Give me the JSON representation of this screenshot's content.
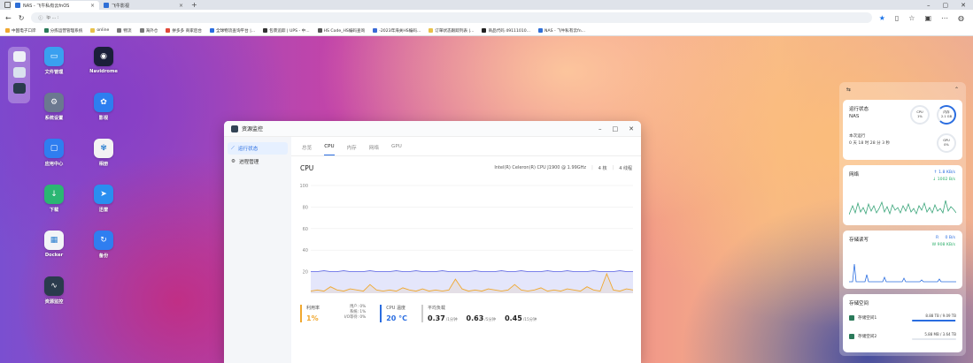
{
  "browser": {
    "tabs": [
      {
        "label": "NAS - 飞牛私有云fnOS",
        "active": true
      },
      {
        "label": "飞牛影视",
        "active": false
      }
    ],
    "address": "ip ... :",
    "bookmarks": [
      "中国电子口岸",
      "分拣运营管理系统",
      "online",
      "物流",
      "海外仓",
      "拼多多 商家后台",
      "全球物流查询平台 |...",
      "包裹追踪 | UPS - 中...",
      "HS Code_HS编码查询",
      "-2023年海关HS编码...",
      "订單状态跟踪列表 |...",
      "商品代码 49111010...",
      "NAS - 飞牛私有云fn..."
    ]
  },
  "desktop": {
    "icons": [
      {
        "label": "文件管理",
        "color": "#3aa0f0",
        "glyph": "▭",
        "icon": "folder-icon"
      },
      {
        "label": "Navidrome",
        "color": "#1b1f3a",
        "glyph": "◉",
        "icon": "music-disc-icon"
      },
      {
        "label": "系统设置",
        "color": "#6b7890",
        "glyph": "⚙",
        "icon": "gear-icon"
      },
      {
        "label": "影视",
        "color": "#2e7ef0",
        "glyph": "✿",
        "icon": "film-icon"
      },
      {
        "label": "应用中心",
        "color": "#2f7ef0",
        "glyph": "▢",
        "icon": "app-store-icon"
      },
      {
        "label": "相册",
        "color": "#f3f3f3",
        "glyph": "✾",
        "icon": "photos-icon"
      },
      {
        "label": "下载",
        "color": "#2bb673",
        "glyph": "↓",
        "icon": "download-icon"
      },
      {
        "label": "迅雷",
        "color": "#2a8ef0",
        "glyph": "➤",
        "icon": "thunder-icon"
      },
      {
        "label": "Docker",
        "color": "#f2f4f7",
        "glyph": "▦",
        "icon": "docker-icon"
      },
      {
        "label": "备份",
        "color": "#2f7ef0",
        "glyph": "↻",
        "icon": "backup-icon"
      },
      {
        "label": "资源监控",
        "color": "#2a3b4d",
        "glyph": "∿",
        "icon": "monitor-icon"
      }
    ]
  },
  "monitor": {
    "title": "资源监控",
    "sidebar": [
      "运行状态",
      "进程管理"
    ],
    "tabs": [
      "总览",
      "CPU",
      "内存",
      "网络",
      "GPU"
    ],
    "active_tab": 1,
    "section_title": "CPU",
    "cpu_model": "Intel(R) Celeron(R) CPU J1900 @ 1.99GHz",
    "cores": "4 核",
    "threads": "4 线程",
    "usage": {
      "label": "利用率",
      "value": "1%",
      "user_label": "用户:",
      "user": "0%",
      "system_label": "系统:",
      "system": "1%",
      "io_label": "I/O等待:",
      "io": "0%"
    },
    "temp": {
      "label": "CPU 温度",
      "value": "20 °C"
    },
    "load": {
      "label": "平均负载",
      "m1": "0.37",
      "m1_unit": "/1分钟",
      "m5": "0.63",
      "m5_unit": "/5分钟",
      "m15": "0.45",
      "m15_unit": "/15分钟"
    },
    "colors": {
      "usage_line": "#f0a830",
      "temp_line": "#6a72e8",
      "accent": "#2a6de0"
    }
  },
  "chart_data": {
    "type": "line",
    "ylim": [
      0,
      100
    ],
    "yticks": [
      20,
      40,
      60,
      80,
      100
    ],
    "series": [
      {
        "values": [
          20,
          20,
          21,
          20,
          20,
          21,
          20,
          20,
          20,
          21,
          20,
          20,
          20,
          21,
          20,
          20,
          21,
          20,
          20,
          20,
          21,
          20,
          20,
          20,
          20,
          21,
          20,
          20,
          20,
          21,
          20,
          20,
          21,
          20,
          20,
          20,
          21,
          20,
          20,
          21,
          20,
          20,
          20,
          21,
          20,
          20,
          20,
          21,
          20,
          20
        ]
      },
      {
        "values": [
          2,
          3,
          2,
          6,
          3,
          2,
          4,
          3,
          2,
          8,
          3,
          2,
          3,
          2,
          5,
          3,
          2,
          4,
          2,
          3,
          2,
          3,
          13,
          4,
          2,
          3,
          2,
          4,
          3,
          2,
          3,
          8,
          3,
          2,
          3,
          5,
          2,
          3,
          2,
          4,
          3,
          2,
          6,
          3,
          2,
          18,
          3,
          2,
          4,
          3
        ]
      }
    ]
  },
  "widgets": {
    "header_icon": "⇆",
    "collapse_icon": "⌃",
    "status": {
      "title": "运行状态",
      "device": "NAS",
      "uptime_label": "本次运行",
      "uptime": "0 天 18 时 28 分 3 秒",
      "cpu": {
        "label": "CPU",
        "value": "1%"
      },
      "memory": {
        "label": "内存",
        "value": "2.1 GB"
      },
      "gpu": {
        "label": "GPU",
        "value": "0%"
      }
    },
    "network": {
      "title": "网络",
      "up": "1.8 KB/s",
      "down": "1002 B/s",
      "up_arrow": "↑",
      "down_arrow": "↓"
    },
    "disk_io": {
      "title": "存储读写",
      "read_label": "R",
      "read": "0 B/s",
      "write_label": "W",
      "write": "908 KB/s"
    },
    "storage": {
      "title": "存储空间",
      "volumes": [
        {
          "name": "存储空间1",
          "usage": "8.88 TB / 9.09 TB",
          "fraction": 0.97
        },
        {
          "name": "存储空间2",
          "usage": "5.88 MB / 3.64 TB",
          "fraction": 0.0
        }
      ]
    }
  }
}
